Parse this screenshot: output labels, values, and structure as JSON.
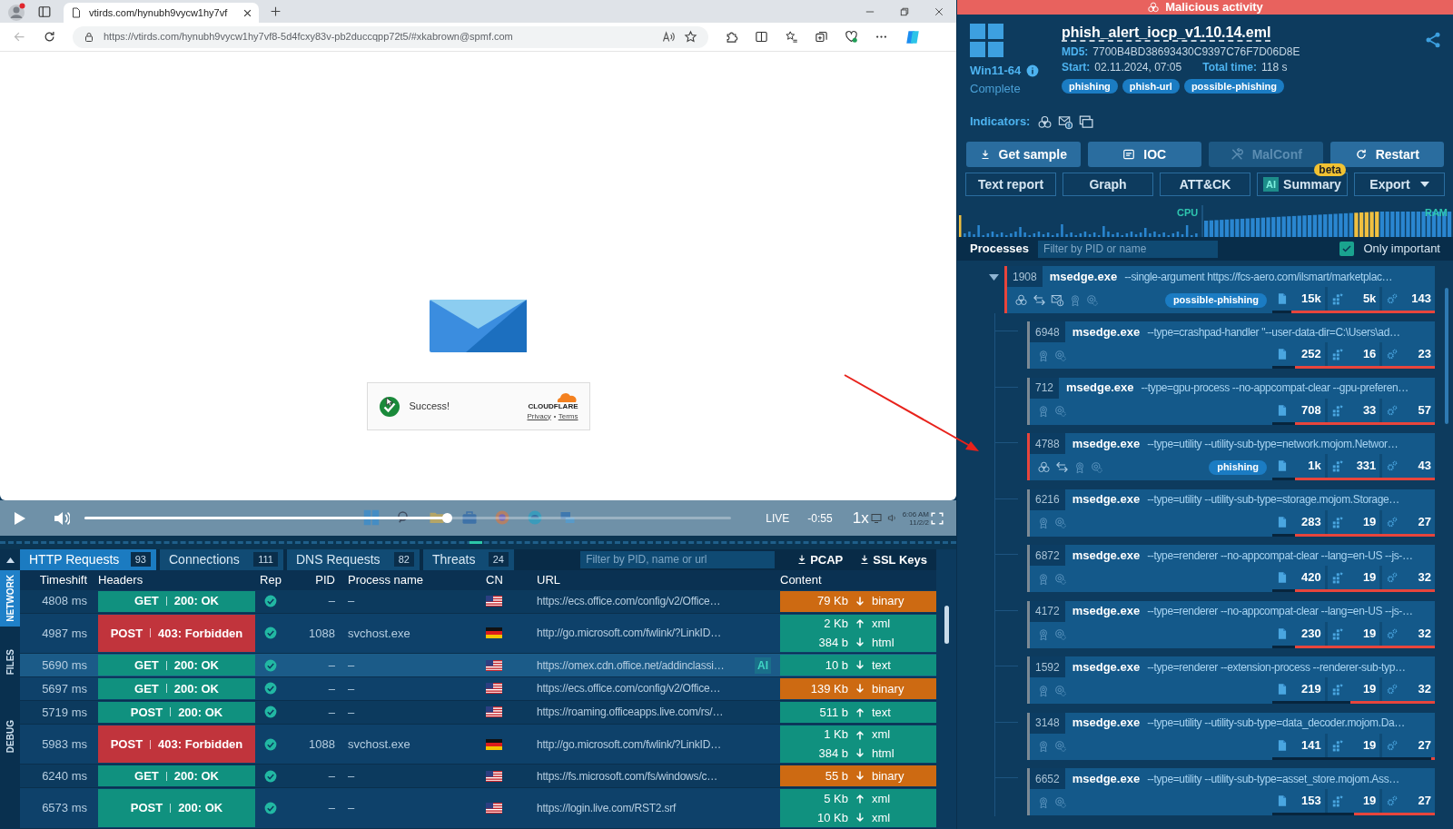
{
  "browser": {
    "tab_title": "vtirds.com/hynubh9vycw1hy7vf",
    "url": "https://vtirds.com/hynubh9vycw1hy7vf8-5d4fcxy83v-pb2duccqpp72t5/#xkabrown@spmf.com"
  },
  "page": {
    "widget": {
      "status": "Success!",
      "brand": "CLOUDFLARE",
      "links": [
        "Privacy",
        "Terms"
      ]
    }
  },
  "player": {
    "level": 0.56,
    "live": "LIVE",
    "remaining": "-0:55",
    "speed": "1x",
    "clock_time": "6:06 AM",
    "clock_date": "11/2/2"
  },
  "side_tabs": [
    {
      "label": "NETWORK",
      "selected": true
    },
    {
      "label": "FILES",
      "selected": false
    },
    {
      "label": "DEBUG",
      "selected": false
    }
  ],
  "tabs": [
    {
      "label": "HTTP Requests",
      "count": "93",
      "selected": true
    },
    {
      "label": "Connections",
      "count": "111",
      "selected": false
    },
    {
      "label": "DNS Requests",
      "count": "82",
      "selected": false
    },
    {
      "label": "Threats",
      "count": "24",
      "selected": false
    }
  ],
  "filter": {
    "placeholder": "Filter by PID, name or url"
  },
  "downloads": [
    "PCAP",
    "SSL Keys"
  ],
  "table": {
    "columns": [
      "Timeshift",
      "Headers",
      "Rep",
      "PID",
      "Process name",
      "CN",
      "URL",
      "Content"
    ],
    "rows": [
      {
        "timeshift": "4808 ms",
        "method": "GET",
        "status": "200: OK",
        "error": false,
        "pid": "–",
        "process": "–",
        "cn": {
          "kind": "us"
        },
        "url": "https://ecs.office.com/config/v2/Office…",
        "selected": false,
        "color": "#cd6a12",
        "content": [
          {
            "size": "79 Kb",
            "kind": "download",
            "type": "binary"
          }
        ]
      },
      {
        "timeshift": "4987 ms",
        "method": "POST",
        "status": "403: Forbidden",
        "error": true,
        "pid": "1088",
        "process": "svchost.exe",
        "cn": {
          "kind": "de"
        },
        "url": "http://go.microsoft.com/fwlink/?LinkID…",
        "selected": false,
        "color": "#10917f",
        "content": [
          {
            "size": "2 Kb",
            "kind": "upload",
            "type": "xml"
          },
          {
            "size": "384 b",
            "kind": "download",
            "type": "html"
          }
        ]
      },
      {
        "timeshift": "5690 ms",
        "method": "GET",
        "status": "200: OK",
        "error": false,
        "pid": "–",
        "process": "–",
        "cn": {
          "kind": "us"
        },
        "url": "https://omex.cdn.office.net/addinclassi…",
        "ai_badge": "AI",
        "selected": true,
        "color": "#10917f",
        "content": [
          {
            "size": "10 b",
            "kind": "download",
            "type": "text"
          }
        ]
      },
      {
        "timeshift": "5697 ms",
        "method": "GET",
        "status": "200: OK",
        "error": false,
        "pid": "–",
        "process": "–",
        "cn": {
          "kind": "us"
        },
        "url": "https://ecs.office.com/config/v2/Office…",
        "selected": false,
        "color": "#cd6a12",
        "content": [
          {
            "size": "139 Kb",
            "kind": "download",
            "type": "binary"
          }
        ]
      },
      {
        "timeshift": "5719 ms",
        "method": "POST",
        "status": "200: OK",
        "error": false,
        "pid": "–",
        "process": "–",
        "cn": {
          "kind": "us"
        },
        "url": "https://roaming.officeapps.live.com/rs/…",
        "selected": false,
        "color": "#10917f",
        "content": [
          {
            "size": "511 b",
            "kind": "upload",
            "type": "text"
          }
        ]
      },
      {
        "timeshift": "5983 ms",
        "method": "POST",
        "status": "403: Forbidden",
        "error": true,
        "pid": "1088",
        "process": "svchost.exe",
        "cn": {
          "kind": "de"
        },
        "url": "http://go.microsoft.com/fwlink/?LinkID…",
        "selected": false,
        "color": "#10917f",
        "content": [
          {
            "size": "1 Kb",
            "kind": "upload",
            "type": "xml"
          },
          {
            "size": "384 b",
            "kind": "download",
            "type": "html"
          }
        ]
      },
      {
        "timeshift": "6240 ms",
        "method": "GET",
        "status": "200: OK",
        "error": false,
        "pid": "–",
        "process": "–",
        "cn": {
          "kind": "us"
        },
        "url": "https://fs.microsoft.com/fs/windows/c…",
        "selected": false,
        "color": "#cd6a12",
        "content": [
          {
            "size": "55 b",
            "kind": "download",
            "type": "binary"
          }
        ]
      },
      {
        "timeshift": "6573 ms",
        "method": "POST",
        "status": "200: OK",
        "error": false,
        "pid": "–",
        "process": "–",
        "cn": {
          "kind": "us"
        },
        "url": "https://login.live.com/RST2.srf",
        "selected": false,
        "color": "#10917f",
        "content": [
          {
            "size": "5 Kb",
            "kind": "upload",
            "type": "xml"
          },
          {
            "size": "10 Kb",
            "kind": "download",
            "type": "xml"
          }
        ]
      }
    ]
  },
  "report": {
    "banner": "Malicious activity",
    "os": "Win11-64",
    "state": "Complete",
    "file": "phish_alert_iocp_v1.10.14.eml",
    "md5_label": "MD5:",
    "md5": "7700B4BD38693430C9397C76F7D06D8E",
    "start_label": "Start:",
    "start": "02.11.2024, 07:05",
    "total_label": "Total time:",
    "total": "118 s",
    "tags": [
      "phishing",
      "phish-url",
      "possible-phishing"
    ],
    "indicators_label": "Indicators:",
    "actions": [
      {
        "label": "Get sample",
        "kind": "download",
        "disabled": false
      },
      {
        "label": "IOC",
        "kind": "list",
        "disabled": false
      },
      {
        "label": "MalConf",
        "kind": "wrench",
        "disabled": true
      },
      {
        "label": "Restart",
        "kind": "refresh",
        "disabled": false
      }
    ],
    "views": [
      {
        "label": "Text report"
      },
      {
        "label": "Graph"
      },
      {
        "label": "ATT&CK"
      },
      {
        "label": "Summary",
        "ai": "AI",
        "badge": "beta"
      },
      {
        "label": "Export",
        "dropdown": true
      }
    ],
    "cpu_label": "CPU",
    "ram_label": "RAM"
  },
  "processes": {
    "title": "Processes",
    "filter_placeholder": "Filter by PID or name",
    "only_important": {
      "label": "Only important",
      "checked": true
    },
    "tree": [
      {
        "pid": "1908",
        "name": "msedge.exe",
        "args": "--single-argument https://fcs-aero.com/ilsmart/marketplac…",
        "malicious": true,
        "threat": true,
        "connections": true,
        "mail": true,
        "tag": "possible-phishing",
        "stats": [
          "15k",
          "5k",
          "143"
        ],
        "level": 0.88,
        "expanded": true,
        "children": [
          {
            "pid": "6948",
            "name": "msedge.exe",
            "args": "--type=crashpad-handler \"--user-data-dir=C:\\Users\\ad…",
            "malicious": false,
            "stats": [
              "252",
              "16",
              "23"
            ],
            "level": 0.86
          },
          {
            "pid": "712",
            "name": "msedge.exe",
            "args": "--type=gpu-process --no-appcompat-clear --gpu-preferen…",
            "malicious": false,
            "stats": [
              "708",
              "33",
              "57"
            ],
            "level": 0.86
          },
          {
            "pid": "4788",
            "name": "msedge.exe",
            "args": "--type=utility --utility-sub-type=network.mojom.Networ…",
            "malicious": true,
            "threat": true,
            "connections": true,
            "tag": "phishing",
            "stats": [
              "1k",
              "331",
              "43"
            ],
            "level": 0.86
          },
          {
            "pid": "6216",
            "name": "msedge.exe",
            "args": "--type=utility --utility-sub-type=storage.mojom.Storage…",
            "malicious": false,
            "stats": [
              "283",
              "19",
              "27"
            ],
            "level": 0.86
          },
          {
            "pid": "6872",
            "name": "msedge.exe",
            "args": "--type=renderer --no-appcompat-clear --lang=en-US --js-…",
            "malicious": false,
            "stats": [
              "420",
              "19",
              "32"
            ],
            "level": 0.86
          },
          {
            "pid": "4172",
            "name": "msedge.exe",
            "args": "--type=renderer --no-appcompat-clear --lang=en-US --js-…",
            "malicious": false,
            "stats": [
              "230",
              "19",
              "32"
            ],
            "level": 0.86
          },
          {
            "pid": "1592",
            "name": "msedge.exe",
            "args": "--type=renderer --extension-process --renderer-sub-typ…",
            "malicious": false,
            "stats": [
              "219",
              "19",
              "32"
            ],
            "level": 0.52
          },
          {
            "pid": "3148",
            "name": "msedge.exe",
            "args": "--type=utility --utility-sub-type=data_decoder.mojom.Da…",
            "malicious": false,
            "stats": [
              "141",
              "19",
              "27"
            ],
            "level": 0.02
          },
          {
            "pid": "6652",
            "name": "msedge.exe",
            "args": "--type=utility --utility-sub-type=asset_store.mojom.Ass…",
            "malicious": false,
            "stats": [
              "153",
              "19",
              "27"
            ],
            "level": 0.5
          }
        ]
      }
    ]
  }
}
